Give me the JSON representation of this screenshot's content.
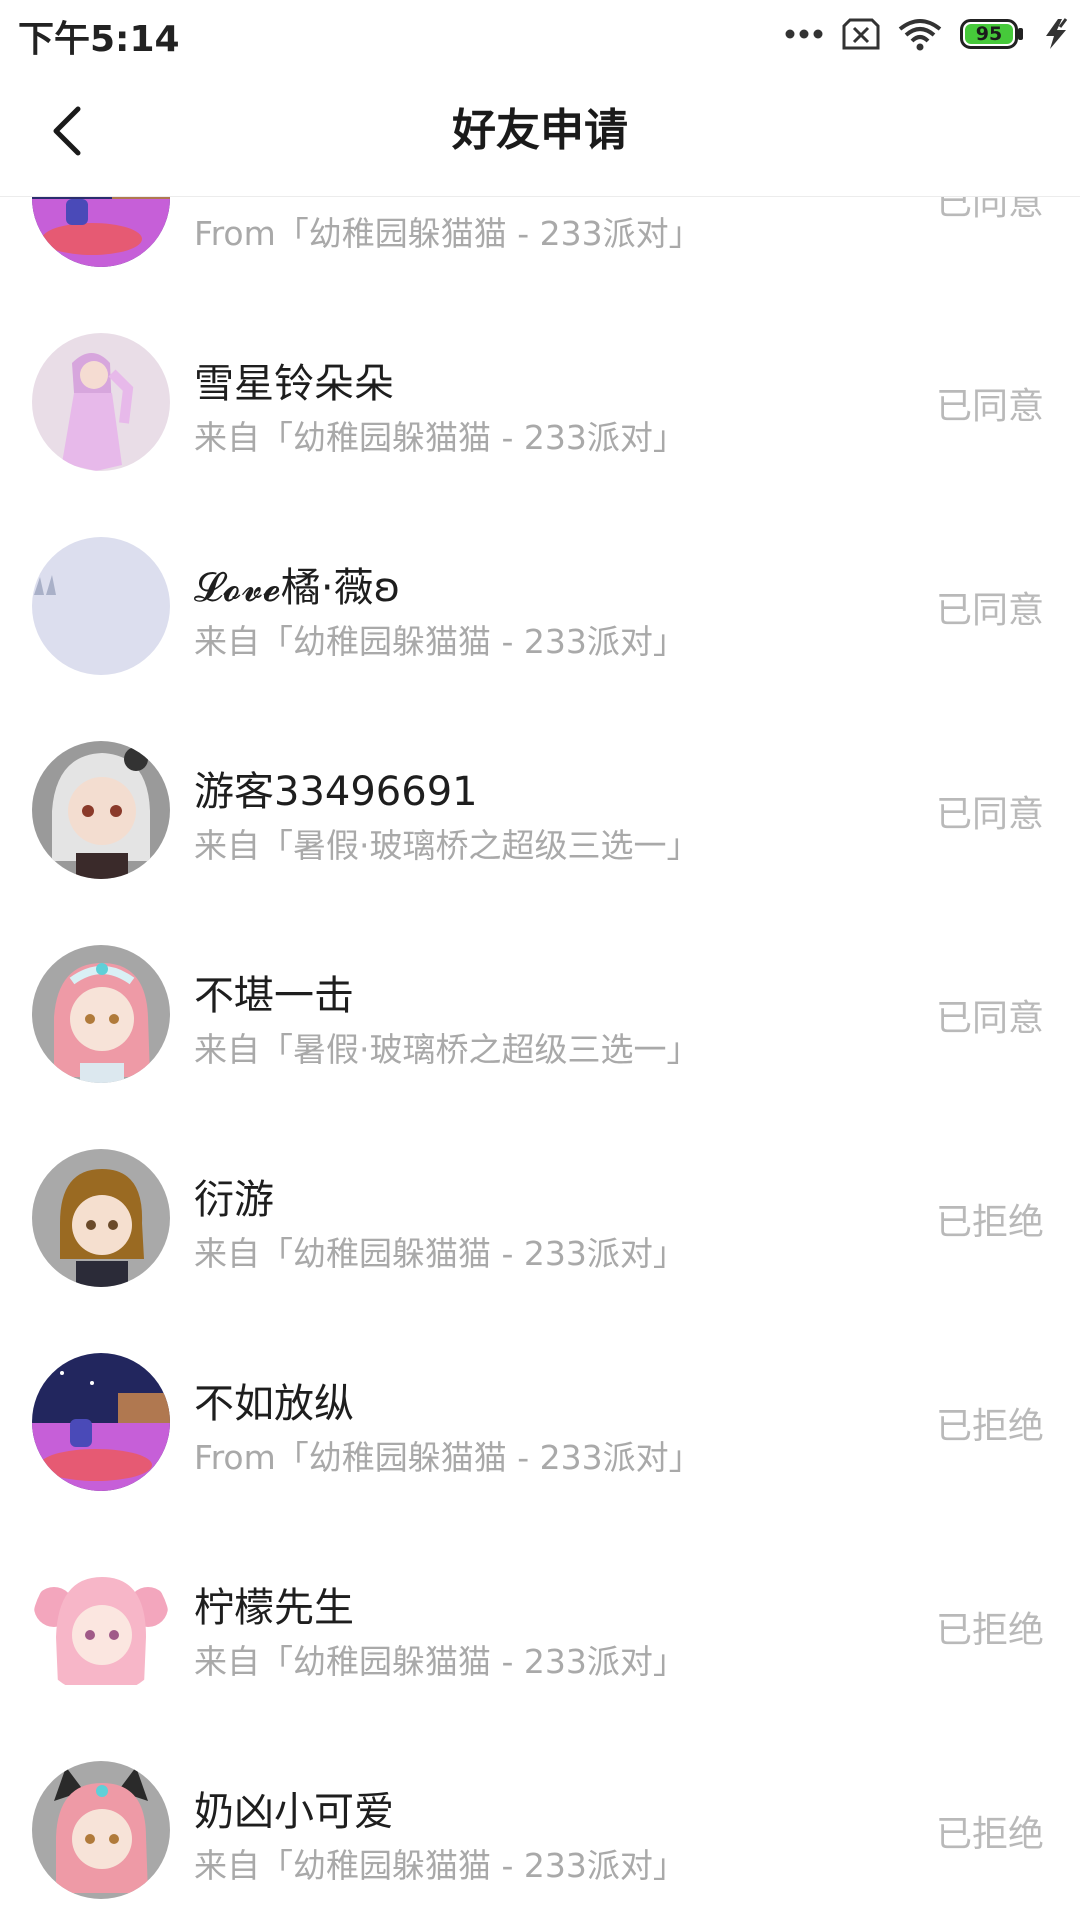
{
  "status_bar": {
    "time": "下午5:14",
    "battery_level": "95",
    "icons": [
      "more-dots-icon",
      "sim-disabled-icon",
      "wifi-icon",
      "battery-icon",
      "charging-icon"
    ],
    "battery_color": "#46c93a"
  },
  "header": {
    "title": "好友申请",
    "back_icon": "chevron-left-icon"
  },
  "requests": [
    {
      "name": "",
      "source": "From「幼稚园躲猫猫 - 233派对」",
      "status": "已同意",
      "avatar": "room-scene-avatar"
    },
    {
      "name": "雪星铃朵朵",
      "source": "来自「幼稚园躲猫猫 - 233派对」",
      "status": "已同意",
      "avatar": "pink-hair-girl-avatar"
    },
    {
      "name": "𝓛𝓸𝓿𝓮橘·薇ʚ",
      "source": "来自「幼稚园躲猫猫 - 233派对」",
      "status": "已同意",
      "avatar": "blank-lavender-avatar"
    },
    {
      "name": "游客33496691",
      "source": "来自「暑假·玻璃桥之超级三选一」",
      "status": "已同意",
      "avatar": "silver-hair-girl-avatar"
    },
    {
      "name": "不堪一击",
      "source": "来自「暑假·玻璃桥之超级三选一」",
      "status": "已同意",
      "avatar": "pink-hair-tiara-avatar"
    },
    {
      "name": "衍游",
      "source": "来自「幼稚园躲猫猫 - 233派对」",
      "status": "已拒绝",
      "avatar": "brown-hair-girl-avatar"
    },
    {
      "name": "不如放纵",
      "source": "From「幼稚园躲猫猫 - 233派对」",
      "status": "已拒绝",
      "avatar": "room-scene-avatar"
    },
    {
      "name": "柠檬先生",
      "source": "来自「幼稚园躲猫猫 - 233派对」",
      "status": "已拒绝",
      "avatar": "pink-twintails-avatar"
    },
    {
      "name": "奶凶小可爱",
      "source": "来自「幼稚园躲猫猫 - 233派对」",
      "status": "已拒绝",
      "avatar": "cat-ear-girl-avatar"
    }
  ]
}
